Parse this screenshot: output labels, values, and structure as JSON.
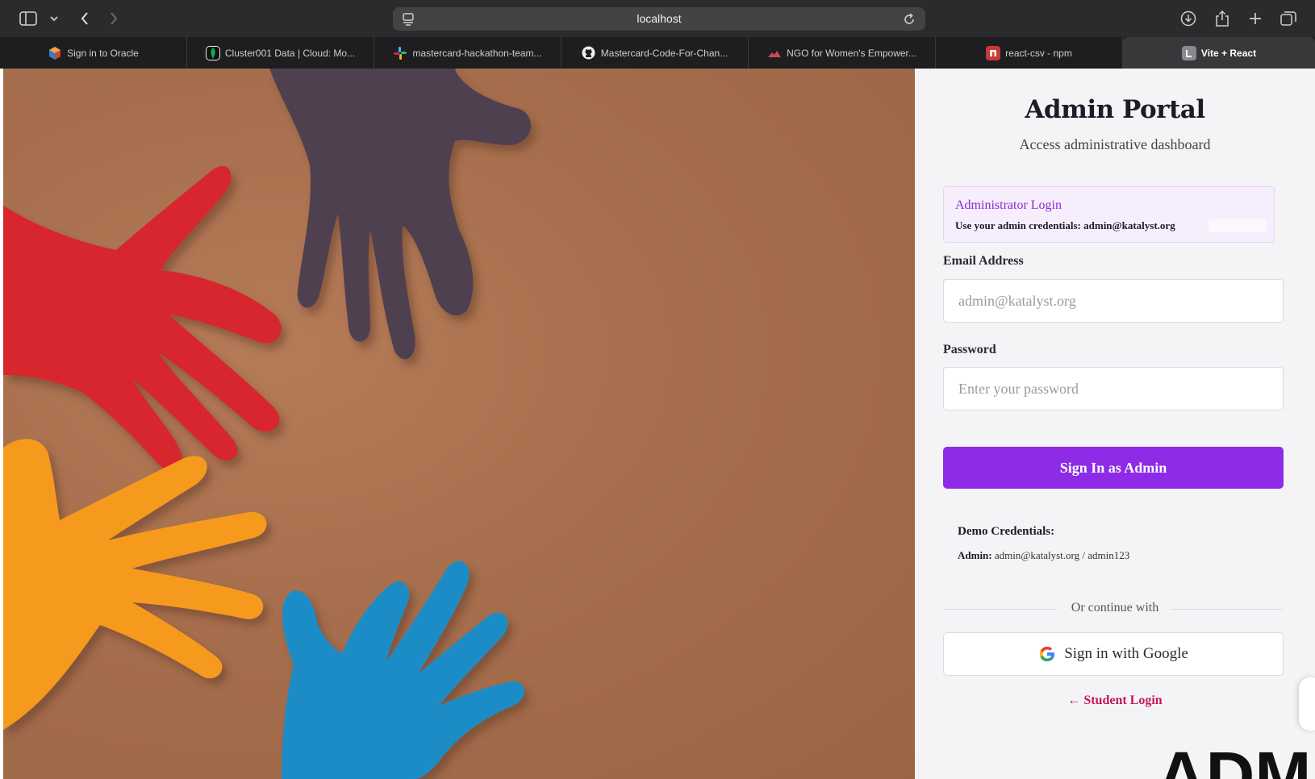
{
  "browser": {
    "url": "localhost",
    "tabs": [
      {
        "label": "Sign in to Oracle",
        "icon": "oracle-icon"
      },
      {
        "label": "Cluster001 Data | Cloud: Mo...",
        "icon": "mongodb-icon"
      },
      {
        "label": "mastercard-hackathon-team...",
        "icon": "slack-icon"
      },
      {
        "label": "Mastercard-Code-For-Chan...",
        "icon": "github-icon"
      },
      {
        "label": "NGO for Women's Empower...",
        "icon": "site-icon"
      },
      {
        "label": "react-csv - npm",
        "icon": "npm-icon"
      },
      {
        "label": "Vite + React",
        "icon": "vite-icon"
      }
    ]
  },
  "login": {
    "title": "Admin Portal",
    "subtitle": "Access administrative dashboard",
    "info_title": "Administrator Login",
    "info_text": "Use your admin credentials: admin@katalyst.org",
    "email_label": "Email Address",
    "email_placeholder": "admin@katalyst.org",
    "password_label": "Password",
    "password_placeholder": "Enter your password",
    "submit_label": "Sign In as Admin",
    "demo_title": "Demo Credentials:",
    "demo_role": "Admin:",
    "demo_value": "admin@katalyst.org / admin123",
    "divider_text": "Or continue with",
    "google_label": "Sign in with Google",
    "student_link": "← Student Login"
  },
  "overlay": {
    "text": "ADM"
  },
  "colors": {
    "accent": "#8e2be6",
    "link": "#c2185b",
    "hero_bg": "#a66e4d",
    "hand_red": "#d7262f",
    "hand_purple": "#4f4150",
    "hand_orange": "#f59a1b",
    "hand_blue": "#1f8cc6"
  }
}
